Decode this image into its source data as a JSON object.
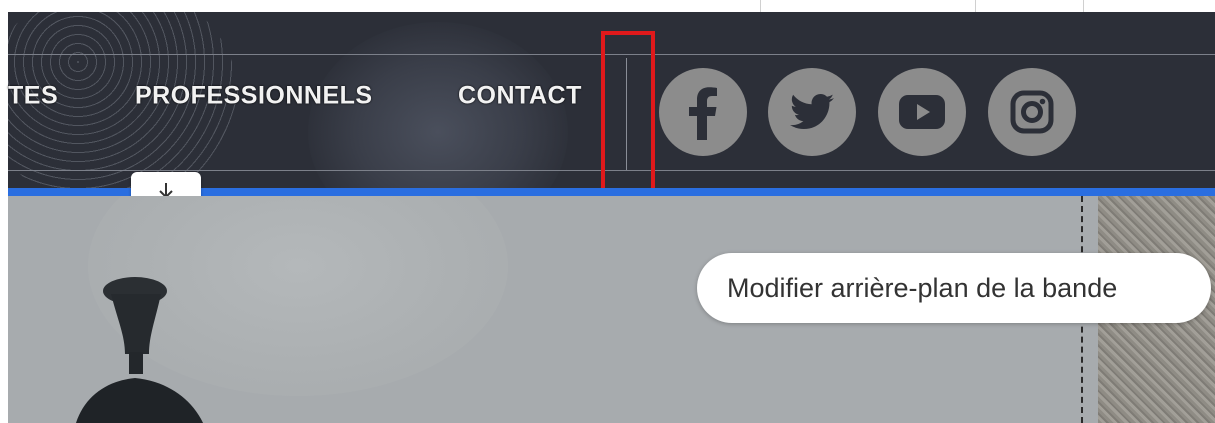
{
  "nav": {
    "items": [
      {
        "label": "TES"
      },
      {
        "label": "PROFESSIONNELS"
      },
      {
        "label": "CONTACT"
      }
    ]
  },
  "social": [
    {
      "icon": "facebook-icon"
    },
    {
      "icon": "twitter-icon"
    },
    {
      "icon": "youtube-icon"
    },
    {
      "icon": "instagram-icon"
    }
  ],
  "strip": {
    "tooltip": "Modifier arrière-plan de la bande",
    "download_icon": "download-icon"
  },
  "colors": {
    "header_bg": "#2c2f38",
    "accent_blue": "#2a6ee0",
    "highlight_red": "#e0191b",
    "social_icon_bg": "#8c8c8c"
  }
}
